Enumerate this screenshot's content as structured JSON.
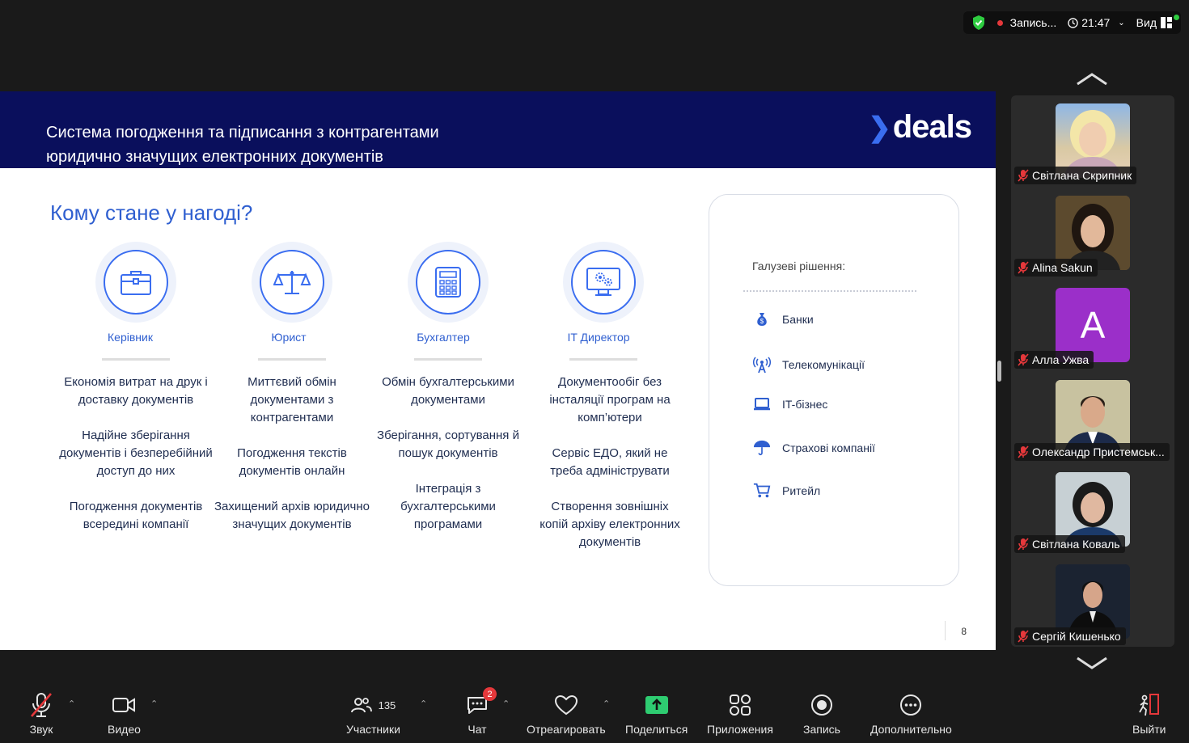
{
  "status_bar": {
    "recording_label": "Запись...",
    "time": "21:47",
    "view_label": "Вид"
  },
  "slide": {
    "title_line1": "Система погодження та підписання з контрагентами",
    "title_line2": "юридично значущих електронних документів",
    "logo_text": "deals",
    "heading": "Кому стане у нагоді?",
    "columns": [
      {
        "role": "Керівник",
        "points": [
          "Економія витрат на друк і доставку документів",
          "Надійне зберігання документів і безперебійний доступ до них",
          "Погодження документів всередині компанії"
        ]
      },
      {
        "role": "Юрист",
        "points": [
          "Миттєвий обмін документами з контрагентами",
          "Погодження текстів документів онлайн",
          "Захищений архів юридично значущих документів"
        ]
      },
      {
        "role": "Бухгалтер",
        "points": [
          "Обмін бухгалтерськими документами",
          "Зберігання, сортування й пошук документів",
          "Інтеграція з бухгалтерськими програмами"
        ]
      },
      {
        "role": "IT Директор",
        "points": [
          "Документообіг без інсталяції програм на комп’ютери",
          "Сервіс ЕДО, який не треба адмініструвати",
          "Створення зовнішніх копій архіву електронних документів"
        ]
      }
    ],
    "panel": {
      "title": "Галузеві рішення:",
      "items": [
        {
          "label": "Банки",
          "icon": "money-bag-icon"
        },
        {
          "label": "Телекомунікації",
          "icon": "antenna-icon"
        },
        {
          "label": "IT-бізнес",
          "icon": "laptop-icon"
        },
        {
          "label": "Страхові компанії",
          "icon": "umbrella-icon"
        },
        {
          "label": "Ритейл",
          "icon": "cart-icon"
        }
      ]
    },
    "page_number": "8"
  },
  "participants": [
    {
      "name": "Світлана Скрипник"
    },
    {
      "name": "Alina Sakun"
    },
    {
      "name": "Алла Ужва",
      "initial": "A"
    },
    {
      "name": "Олександр Пристемськ..."
    },
    {
      "name": "Світлана Коваль"
    },
    {
      "name": "Сергій Кишенько"
    }
  ],
  "toolbar": {
    "audio": "Звук",
    "video": "Видео",
    "participants": "Участники",
    "participants_count": "135",
    "chat": "Чат",
    "chat_badge": "2",
    "react": "Отреагировать",
    "share": "Поделиться",
    "apps": "Приложения",
    "record": "Запись",
    "more": "Дополнительно",
    "leave": "Выйти"
  }
}
